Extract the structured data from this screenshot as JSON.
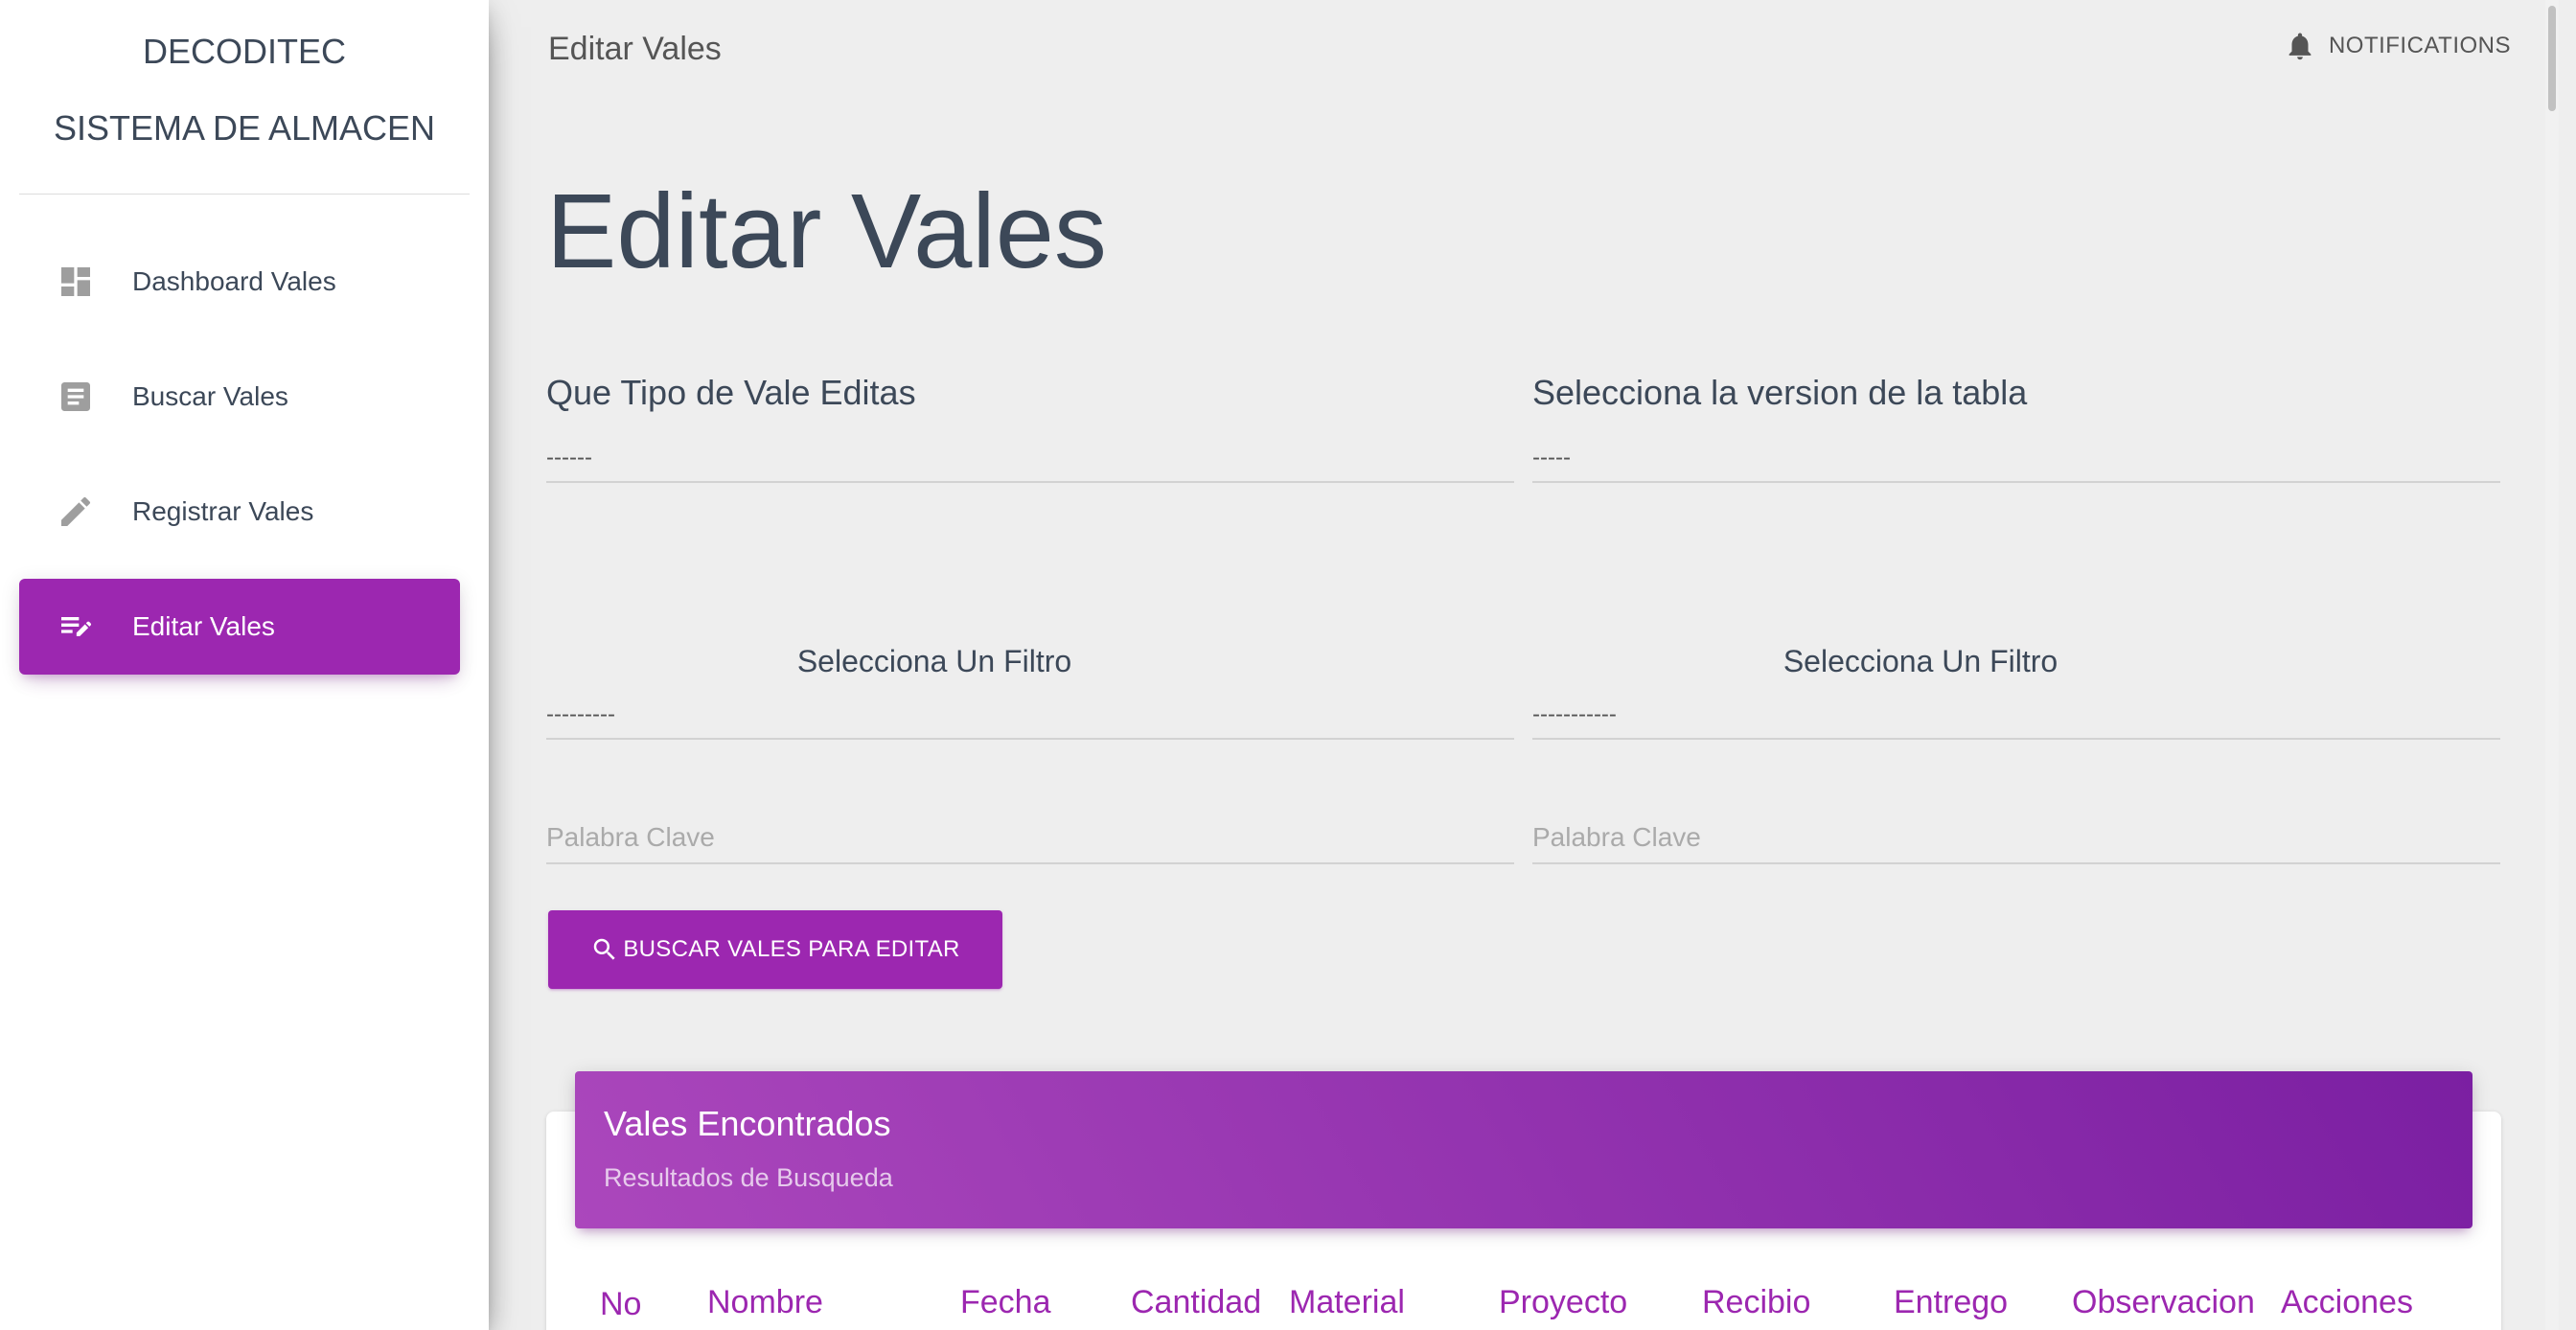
{
  "sidebar": {
    "brand_line1": "DECODITEC",
    "brand_line2": "SISTEMA DE ALMACEN",
    "items": [
      {
        "label": "Dashboard Vales",
        "icon": "dashboard-icon"
      },
      {
        "label": "Buscar Vales",
        "icon": "description-icon"
      },
      {
        "label": "Registrar Vales",
        "icon": "pencil-icon"
      },
      {
        "label": "Editar Vales",
        "icon": "edit-note-icon",
        "active": true
      }
    ]
  },
  "topbar": {
    "title": "Editar Vales",
    "notifications_label": "NOTIFICATIONS"
  },
  "page": {
    "title": "Editar Vales"
  },
  "form": {
    "tipo_vale": {
      "label": "Que Tipo de Vale Editas",
      "value": "------"
    },
    "version_tabla": {
      "label": "Selecciona la version de la tabla",
      "value": "-----"
    },
    "filtro1": {
      "label": "Selecciona Un Filtro",
      "value": "---------"
    },
    "filtro2": {
      "label": "Selecciona Un Filtro",
      "value": "-----------"
    },
    "keyword1_placeholder": "Palabra Clave",
    "keyword2_placeholder": "Palabra Clave",
    "search_button": "BUSCAR VALES PARA EDITAR"
  },
  "results": {
    "title": "Vales Encontrados",
    "subtitle": "Resultados de Busqueda",
    "columns": [
      "No",
      "Nombre",
      "Fecha",
      "Cantidad",
      "Material",
      "Proyecto",
      "Recibio",
      "Entrego",
      "Observacion",
      "Acciones"
    ]
  },
  "colors": {
    "accent": "#9c27b0",
    "background": "#eeeeee"
  }
}
